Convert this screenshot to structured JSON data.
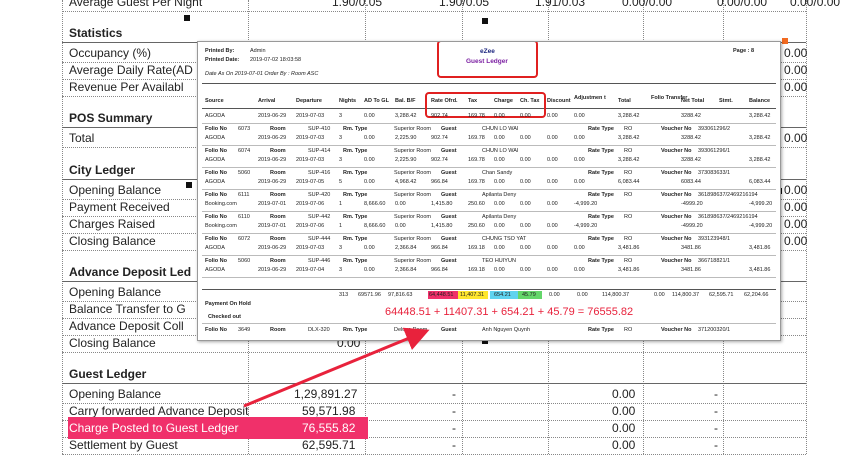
{
  "bg": {
    "top_row": {
      "label": "Average Guest Per Night",
      "v1": "1.90/0.05",
      "v2": "1.90/0.05",
      "v3": "1.91/0.03",
      "v4": "0.00/0.00",
      "v5": "0.00/0.00",
      "v6": "0.00/0.00"
    },
    "statistics": {
      "title": "Statistics",
      "items": [
        "Occupancy (%)",
        "Average Daily Rate(AD",
        "Revenue Per Availabl"
      ],
      "right": [
        "0.00",
        "0.00",
        "0.00"
      ]
    },
    "pos": {
      "title": "POS Summary",
      "items": [
        "Total"
      ],
      "right": [
        "0.00"
      ]
    },
    "city": {
      "title": "City Ledger",
      "items": [
        "Opening Balance",
        "Payment Received",
        "Charges Raised",
        "Closing Balance"
      ],
      "right": [
        "0.00",
        "0.00",
        "0.00",
        "0.00"
      ]
    },
    "advance": {
      "title": "Advance Deposit Led",
      "items": [
        "Opening Balance",
        "Balance Transfer to G",
        "Advance Deposit Coll",
        "Closing Balance"
      ],
      "right": [
        "",
        "",
        "",
        ""
      ],
      "closing_mid": "0.00"
    },
    "guest": {
      "title": "Guest Ledger",
      "rows": [
        {
          "label": "Opening Balance",
          "value": "1,29,891.27",
          "dash": "-",
          "zero": "0.00"
        },
        {
          "label": "Carry forwarded Advance Deposit",
          "value": "59,571.98",
          "dash": "-",
          "zero": "0.00"
        },
        {
          "label": "Charge Posted to Guest Ledger",
          "value": "76,555.82",
          "dash": "-",
          "zero": "0.00"
        },
        {
          "label": "Settlement by Guest",
          "value": "62,595.71",
          "dash": "-",
          "zero": "0.00"
        }
      ]
    }
  },
  "overlay": {
    "printed_by_label": "Printed By:",
    "printed_by": "Admin",
    "printed_date_label": "Printed Date:",
    "printed_date": "2019-07-02 18:03:58",
    "as_on": "Date As On 2019-07-01 Order By : Room ASC",
    "brand": "eZee",
    "report_title": "Guest Ledger",
    "page_label": "Page : 8",
    "headers": [
      "Source",
      "Arrival",
      "Departure",
      "Nights",
      "AD To GL",
      "Bal. B/F",
      "Rate Ofrd.",
      "Tax",
      "Charge",
      "Ch. Tax",
      "Discount",
      "Adjustmen t",
      "Total",
      "Folio Transfer",
      "Net Total",
      "Stmt.",
      "Balance"
    ],
    "entries": [
      {
        "source": "AGODA",
        "arrival": "2019-06-29",
        "departure": "2019-07-03",
        "nights": "3",
        "adgl": "0.00",
        "balbf": "3,288.42",
        "rate": "902.74",
        "tax": "169.78",
        "charge": "0.00",
        "chtax": "0.00",
        "disc": "0.00",
        "adj": "0.00",
        "total": "3,288.42",
        "net": "3288.42",
        "bal": "3,288.42"
      },
      {
        "folio": "6073",
        "room": "SUP-410",
        "rmtype": "Superior Room",
        "guest": "CHUN LO WAI",
        "ratetype": "RO",
        "voucher": "393061296/2",
        "source": "AGODA",
        "arrival": "2019-06-29",
        "departure": "2019-07-03",
        "nights": "3",
        "adgl": "0.00",
        "balbf": "2,225.90",
        "rate": "902.74",
        "tax": "169.78",
        "charge": "0.00",
        "chtax": "0.00",
        "disc": "0.00",
        "adj": "0.00",
        "total": "3,288.42",
        "net": "3288.42",
        "bal": "3,288.42"
      },
      {
        "folio": "6074",
        "room": "SUP-414",
        "rmtype": "Superior Room",
        "guest": "CHUN LO WAI",
        "ratetype": "RO",
        "voucher": "393061296/1",
        "source": "AGODA",
        "arrival": "2019-06-29",
        "departure": "2019-07-03",
        "nights": "3",
        "adgl": "0.00",
        "balbf": "2,225.90",
        "rate": "902.74",
        "tax": "169.78",
        "charge": "0.00",
        "chtax": "0.00",
        "disc": "0.00",
        "adj": "0.00",
        "total": "3,288.42",
        "net": "3288.42",
        "bal": "3,288.42"
      },
      {
        "folio": "5060",
        "room": "SUP-416",
        "rmtype": "Superior Room",
        "guest": "Chan Sandy",
        "ratetype": "RO",
        "voucher": "373083633/1",
        "source": "AGODA",
        "arrival": "2019-06-29",
        "departure": "2019-07-05",
        "nights": "5",
        "adgl": "0.00",
        "balbf": "4,968.42",
        "rate": "966.84",
        "tax": "169.78",
        "charge": "0.00",
        "chtax": "0.00",
        "disc": "0.00",
        "adj": "0.00",
        "total": "6,083.44",
        "net": "6083.44",
        "bal": "6,083.44"
      },
      {
        "folio": "6111",
        "room": "SUP-420",
        "rmtype": "Superior Room",
        "guest": "Apilanta Deny",
        "ratetype": "RO",
        "voucher": "361898637/2469216194",
        "source": "Booking.com",
        "arrival": "2019-07-01",
        "departure": "2019-07-06",
        "nights": "1",
        "adgl": "8,666.60",
        "balbf": "0.00",
        "rate": "1,415.80",
        "tax": "250.60",
        "charge": "0.00",
        "chtax": "0.00",
        "disc": "0.00",
        "adj": "-4,999.20",
        "total": "",
        "net": "-4999.20",
        "bal": "-4,999.20"
      },
      {
        "folio": "6110",
        "room": "SUP-442",
        "rmtype": "Superior Room",
        "guest": "Apilanta Deny",
        "ratetype": "RO",
        "voucher": "361898637/2469216194",
        "source": "Booking.com",
        "arrival": "2019-07-01",
        "departure": "2019-07-06",
        "nights": "1",
        "adgl": "8,666.60",
        "balbf": "0.00",
        "rate": "1,415.80",
        "tax": "250.60",
        "charge": "0.00",
        "chtax": "0.00",
        "disc": "0.00",
        "adj": "-4,999.20",
        "total": "",
        "net": "-4999.20",
        "bal": "-4,999.20"
      },
      {
        "folio": "6072",
        "room": "SUP-444",
        "rmtype": "Superior Room",
        "guest": "CHUNG TSO YAT",
        "ratetype": "RO",
        "voucher": "393123948/1",
        "source": "AGODA",
        "arrival": "2019-06-29",
        "departure": "2019-07-03",
        "nights": "3",
        "adgl": "0.00",
        "balbf": "2,366.84",
        "rate": "966.84",
        "tax": "169.18",
        "charge": "0.00",
        "chtax": "0.00",
        "disc": "0.00",
        "adj": "0.00",
        "total": "3,481.86",
        "net": "3481.86",
        "bal": "3,481.86"
      },
      {
        "folio": "5060",
        "room": "SUP-446",
        "rmtype": "Superior Room",
        "guest": "TEO HUIYUN",
        "ratetype": "RO",
        "voucher": "366718821/1",
        "source": "AGODA",
        "arrival": "2019-06-29",
        "departure": "2019-07-04",
        "nights": "3",
        "adgl": "0.00",
        "balbf": "2,366.84",
        "rate": "966.84",
        "tax": "169.18",
        "charge": "0.00",
        "chtax": "0.00",
        "disc": "0.00",
        "adj": "0.00",
        "total": "3,481.86",
        "net": "3481.86",
        "bal": "3,481.86"
      }
    ],
    "labels": {
      "folio": "Folio No",
      "room": "Room",
      "rmtype": "Rm. Type",
      "guest": "Guest",
      "ratetype": "Rate Type",
      "voucher": "Voucher No"
    },
    "totals": {
      "nights": "313",
      "adgl": "69571.96",
      "balbf": "97,816.63",
      "rate": "64,448.51",
      "tax": "11,407.31",
      "charge": "654.21",
      "chtax": "45.79",
      "disc": "0.00",
      "adj": "0.00",
      "total": "114,800.37",
      "ft": "0.00",
      "net": "114,800.37",
      "stmt": "62,595.71",
      "bal": "62,204.66"
    },
    "payment_on_hold": "Payment On Hold",
    "checked_out": "Checked out",
    "last": {
      "folio": "3649",
      "room": "DLX-320",
      "rmtype": "Deluxe Room",
      "guest": "Anh Nguyen Quynh",
      "ratetype": "RO",
      "voucher": "371200320/1"
    },
    "formula": "64448.51 + 11407.31  + 654.21 + 45.79 = 76555.82"
  },
  "colors": {
    "red": "#e8223c",
    "pink": "#f0306a",
    "yellow": "#ffe62e",
    "cyan": "#5fd3ef",
    "green": "#64d66a",
    "purple": "#7b1fa2"
  }
}
